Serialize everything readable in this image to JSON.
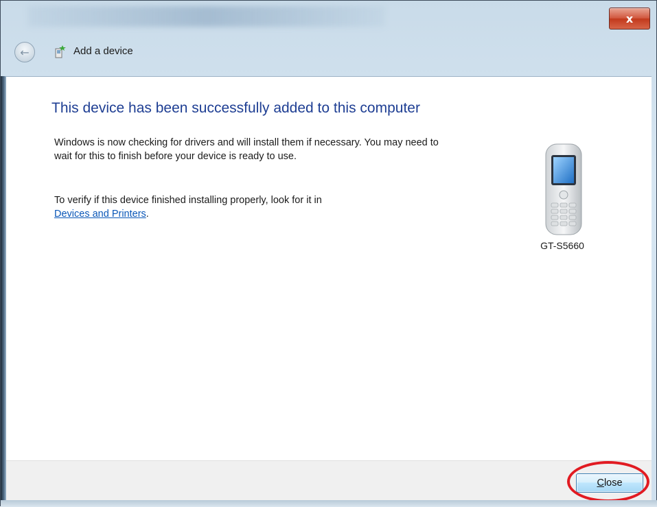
{
  "window": {
    "close_glyph": "x",
    "accent_color": "#1e3e93",
    "annotation_color": "#e11b22"
  },
  "nav": {
    "title": "Add a device",
    "back_icon": "back-arrow-icon",
    "device_icon": "add-device-icon"
  },
  "content": {
    "headline": "This device has been successfully added to this computer",
    "para1": "Windows is now checking for drivers and will install them if necessary. You may need to wait for this to finish before your device is ready to use.",
    "para2_prefix": "To verify if this device finished installing properly, look for it in",
    "link_text": "Devices and Printers",
    "para2_suffix": ".",
    "device": {
      "name": "GT-S5660",
      "icon": "mobile-phone-icon"
    }
  },
  "footer": {
    "close_label_access": "C",
    "close_label_rest": "lose"
  }
}
